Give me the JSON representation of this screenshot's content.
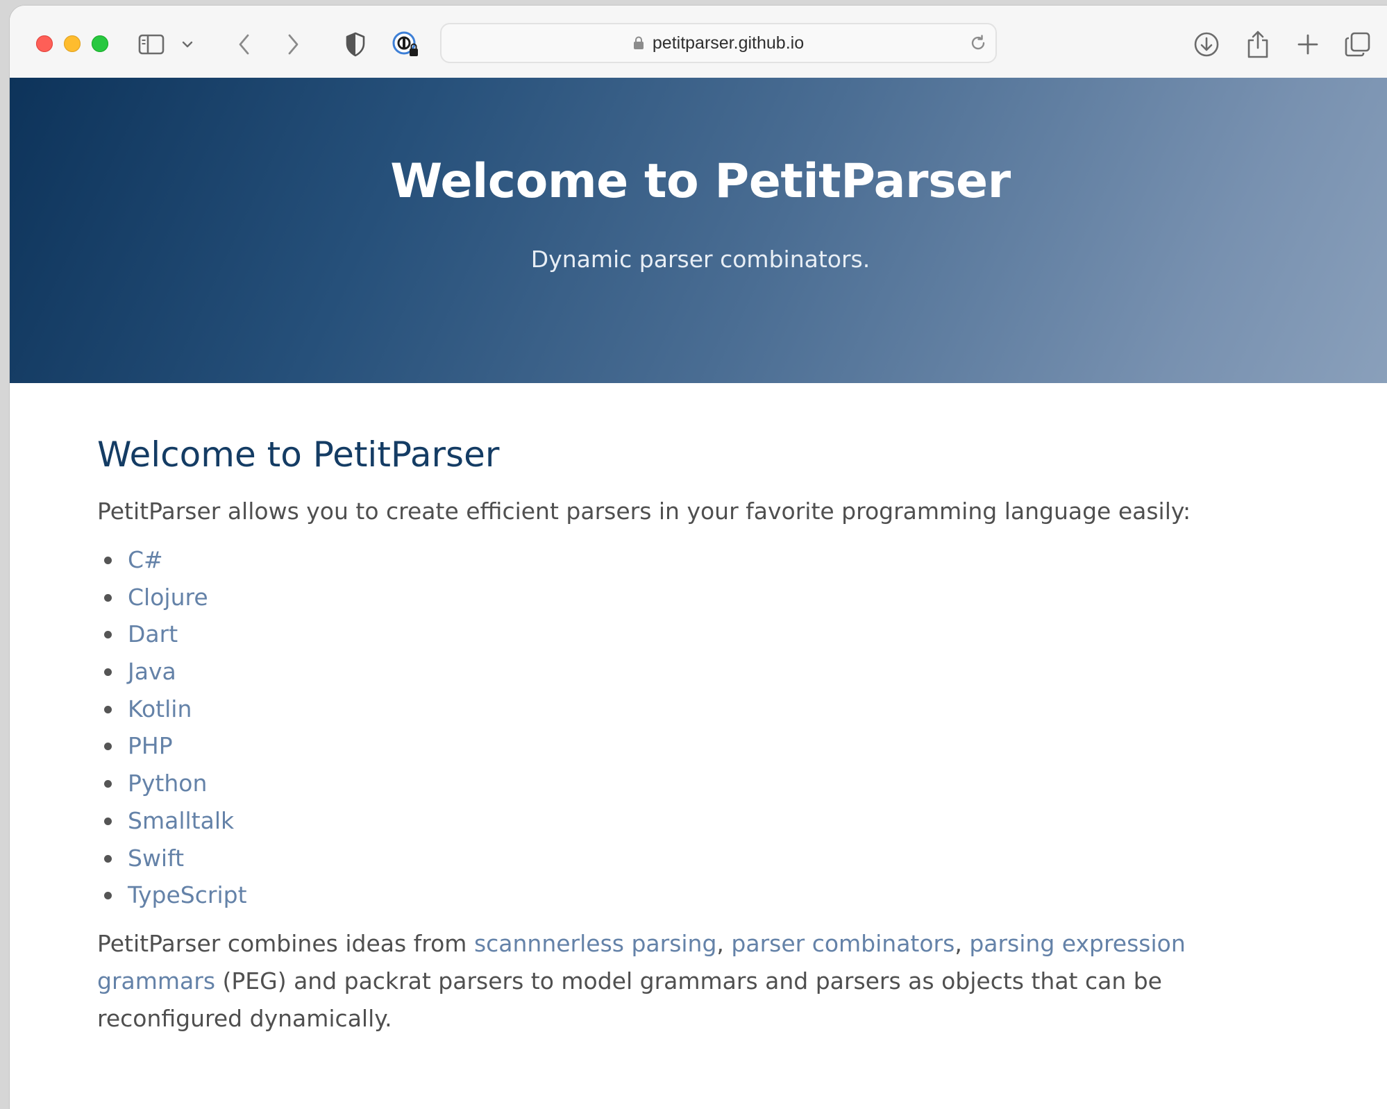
{
  "browser": {
    "url": "petitparser.github.io"
  },
  "hero": {
    "title": "Welcome to PetitParser",
    "subtitle": "Dynamic parser combinators."
  },
  "content": {
    "heading": "Welcome to PetitParser",
    "intro": "PetitParser allows you to create efficient parsers in your favorite programming language easily:",
    "languages": [
      "C#",
      "Clojure",
      "Dart",
      "Java",
      "Kotlin",
      "PHP",
      "Python",
      "Smalltalk",
      "Swift",
      "TypeScript"
    ],
    "outro": {
      "part1": "PetitParser combines ideas from ",
      "link1": "scannnerless parsing",
      "sep1": ", ",
      "link2": "parser combinators",
      "sep2": ", ",
      "link3": "parsing expression grammars",
      "part2": " (PEG) and packrat parsers to model grammars and parsers as objects that can be reconfigured dynamically."
    }
  },
  "colors": {
    "link": "#6482a8",
    "heading": "#143c64",
    "body_text": "#4f4f4f",
    "hero_gradient_start": "#0d335a",
    "hero_gradient_end": "#8aa0bb"
  },
  "icons": {
    "sidebar": "sidebar-icon",
    "sidebar_menu": "chevron-down-icon",
    "back": "chevron-left-icon",
    "forward": "chevron-right-icon",
    "privacy": "shield-icon",
    "password": "password-key-icon",
    "lock": "lock-icon",
    "reload": "reload-icon",
    "download": "download-icon",
    "share": "share-icon",
    "new_tab": "plus-icon",
    "tabs": "tabs-overview-icon"
  }
}
